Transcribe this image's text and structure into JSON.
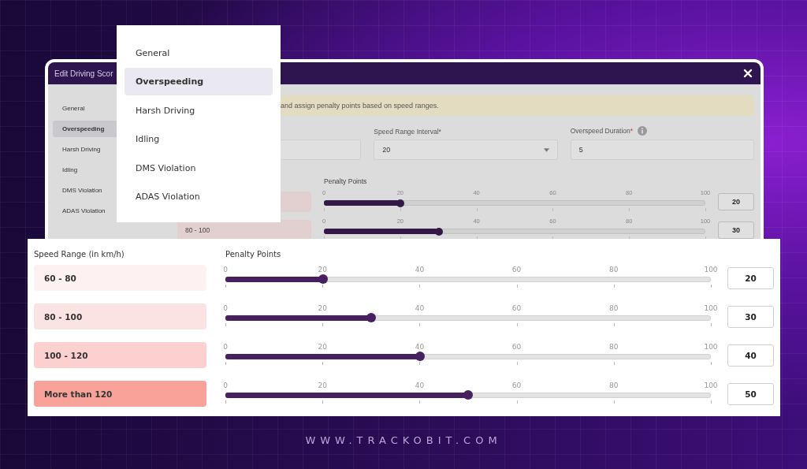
{
  "window": {
    "title": "Edit Driving Scor",
    "sidebar": {
      "items": [
        {
          "label": "General",
          "selected": false
        },
        {
          "label": "Overspeeding",
          "selected": true
        },
        {
          "label": "Harsh Driving",
          "selected": false
        },
        {
          "label": "Idling",
          "selected": false
        },
        {
          "label": "DMS Violation",
          "selected": false
        },
        {
          "label": "ADAS Violation",
          "selected": false
        }
      ]
    },
    "notice": "and assign penalty points based on speed ranges.",
    "fields": [
      {
        "kind": "select",
        "label": "Speed Range Interval ",
        "required_mark": "*",
        "value": "20"
      },
      {
        "kind": "text",
        "label": "Overspeed Duration",
        "required_mark": "*",
        "value": "5",
        "info": true
      }
    ],
    "points_header": "Penalty Points",
    "rows": [
      {
        "level": 0.2,
        "value": "20",
        "marks": [
          "0",
          "20",
          "40",
          "60",
          "80",
          "100"
        ]
      },
      {
        "range": "80 - 100",
        "level": 0.3,
        "value": "30",
        "marks": [
          "0",
          "20",
          "40",
          "60",
          "80",
          "100"
        ]
      }
    ]
  },
  "menu": {
    "items": [
      {
        "label": "General",
        "selected": false
      },
      {
        "label": "Overspeeding",
        "selected": true
      },
      {
        "label": "Harsh Driving",
        "selected": false
      },
      {
        "label": "Idling",
        "selected": false
      },
      {
        "label": "DMS Violation",
        "selected": false
      },
      {
        "label": "ADAS Violation",
        "selected": false
      }
    ]
  },
  "zoom_panel": {
    "range_header": "Speed Range (in km/h)",
    "points_header": "Penalty Points",
    "rows": [
      {
        "range": "60 - 80",
        "color": "#fdf1f1",
        "level": 0.2,
        "value": "20",
        "marks": [
          "0",
          "20",
          "40",
          "60",
          "80",
          "100"
        ]
      },
      {
        "range": "80 - 100",
        "color": "#fbe3e2",
        "level": 0.3,
        "value": "30",
        "marks": [
          "0",
          "20",
          "40",
          "60",
          "80",
          "100"
        ]
      },
      {
        "range": "100 - 120",
        "color": "#fbd0ce",
        "level": 0.4,
        "value": "40",
        "marks": [
          "0",
          "20",
          "40",
          "60",
          "80",
          "100"
        ]
      },
      {
        "range": "More than 120",
        "color": "#f8a299",
        "level": 0.5,
        "value": "50",
        "marks": [
          "0",
          "20",
          "40",
          "60",
          "80",
          "100"
        ]
      }
    ]
  },
  "footer_url": "WWW.TRACKOBIT.COM"
}
